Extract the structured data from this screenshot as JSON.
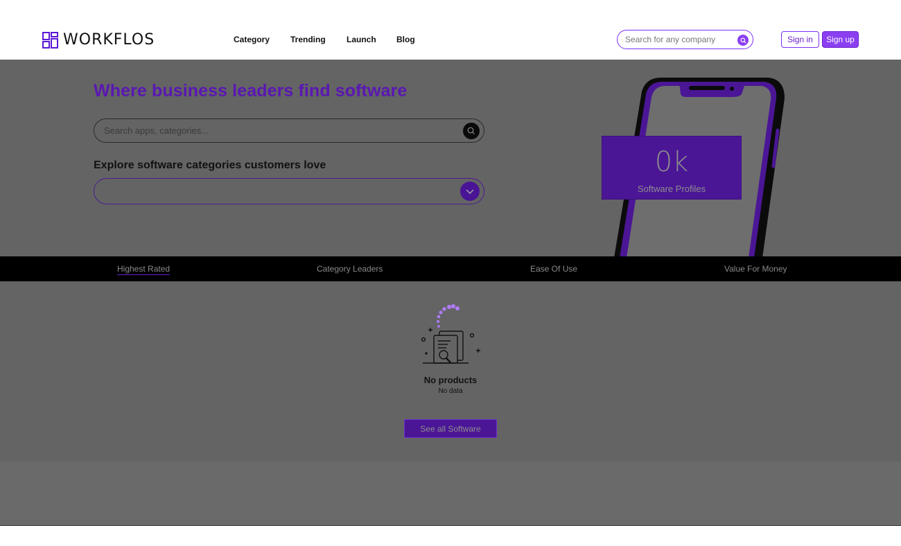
{
  "header": {
    "brand": "WORKFLOS",
    "nav": [
      {
        "label": "Category"
      },
      {
        "label": "Trending"
      },
      {
        "label": "Launch"
      },
      {
        "label": "Blog"
      }
    ],
    "search_placeholder": "Search for any company",
    "signin_label": "Sign in",
    "signup_label": "Sign up"
  },
  "hero": {
    "title": "Where business leaders find software",
    "search_placeholder": "Search apps, categories...",
    "explore_label": "Explore software categories customers love",
    "stat_value": "0k",
    "stat_label": "Software Profiles"
  },
  "tabs": [
    {
      "label": "Highest Rated",
      "active": true
    },
    {
      "label": "Category Leaders"
    },
    {
      "label": "Ease Of Use"
    },
    {
      "label": "Value For Money"
    }
  ],
  "empty_state": {
    "title": "No products",
    "subtitle": "No data",
    "button_label": "See all Software"
  },
  "colors": {
    "accent": "#8b3ff0",
    "accent_dark": "#4b1696",
    "overlay": "#646464"
  }
}
